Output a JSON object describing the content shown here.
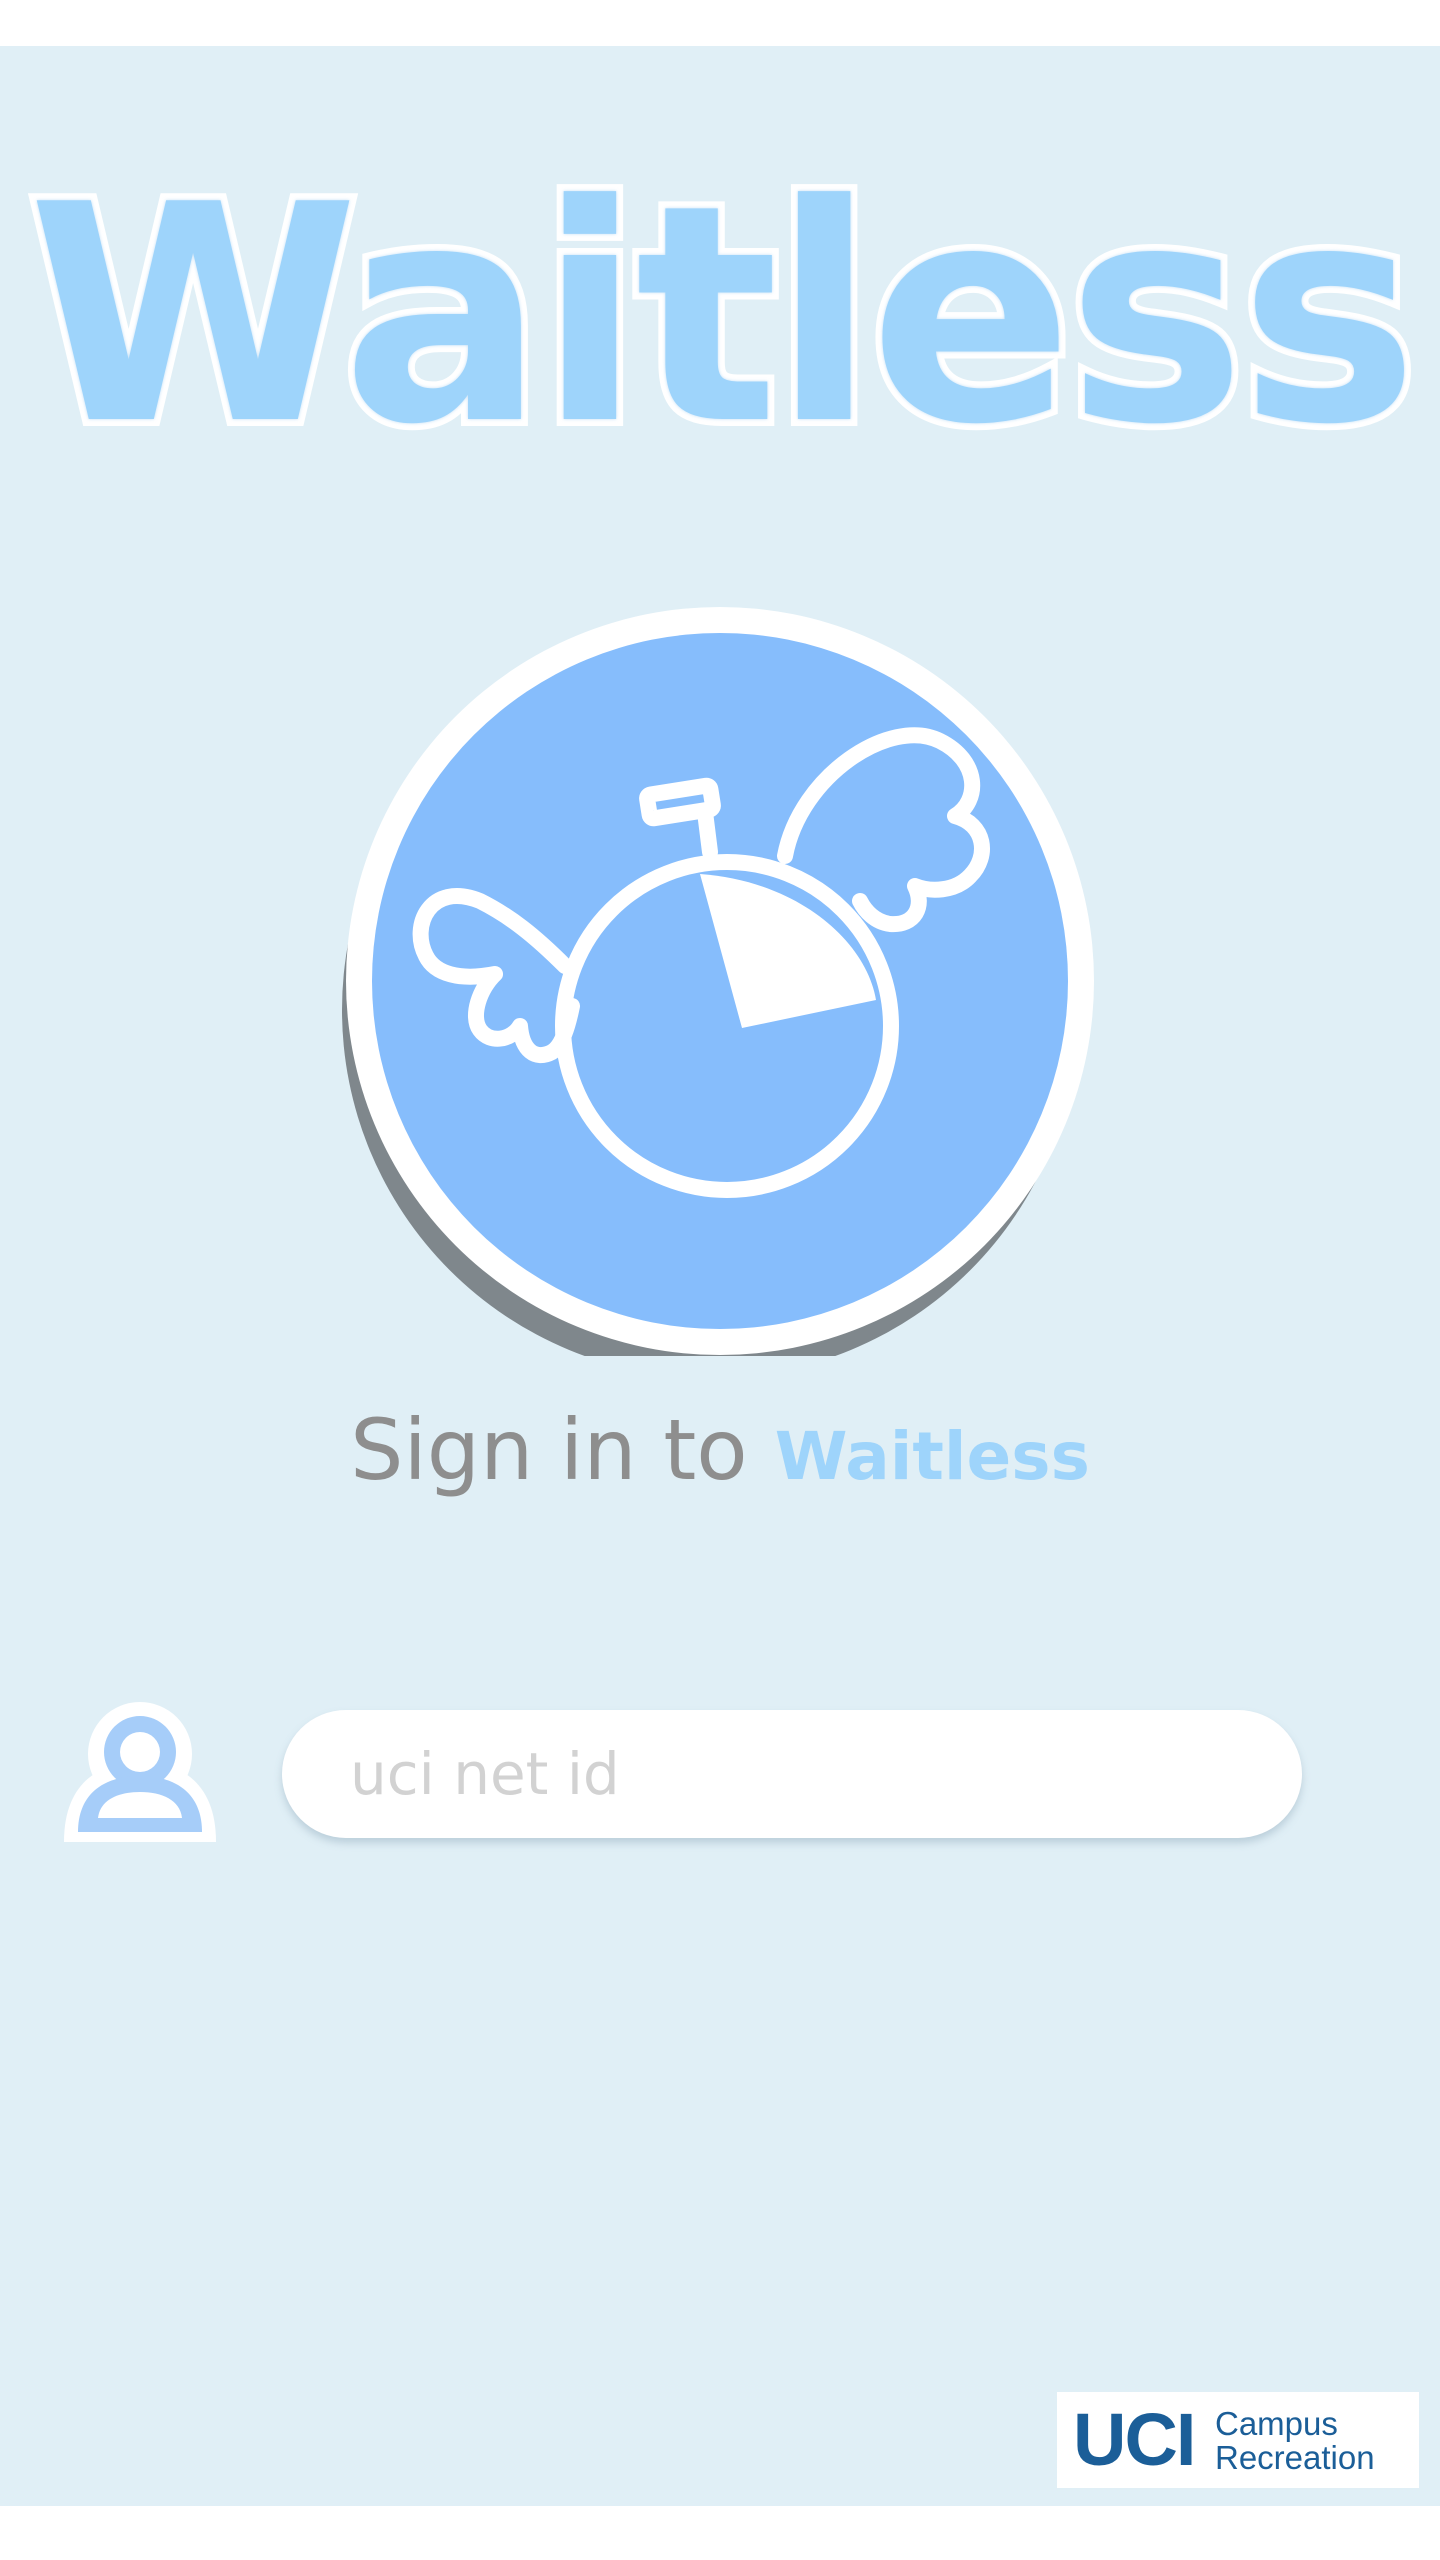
{
  "app": {
    "title": "Waitless"
  },
  "logo": {
    "icon": "winged-stopwatch-icon",
    "circle_color": "#86bdfc",
    "stroke_color": "#ffffff",
    "shadow_color": "#7f878c"
  },
  "signin": {
    "prefix": "Sign in to",
    "brand": "Waitless"
  },
  "login_form": {
    "user_icon": "user-icon",
    "netid_placeholder": "uci net id",
    "netid_value": ""
  },
  "footer_logo": {
    "mark": "UCI",
    "line1": "Campus",
    "line2": "Recreation"
  },
  "colors": {
    "background": "#e0eff6",
    "brand_light_blue": "#9ed4fb",
    "muted_text": "#8e8e8e",
    "uci_blue": "#1b5e98"
  }
}
